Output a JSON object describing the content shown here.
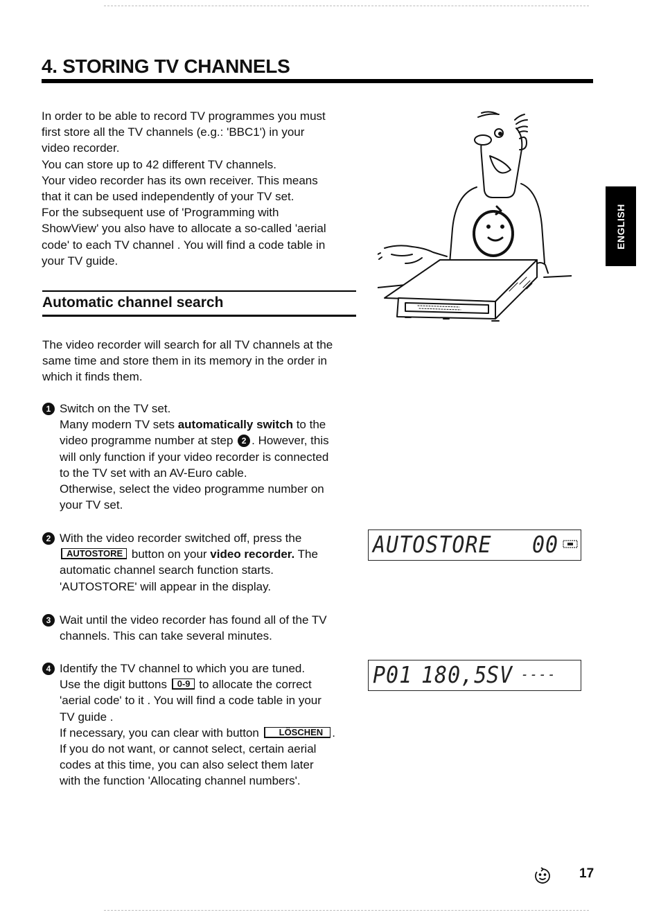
{
  "page": {
    "title": "4. STORING TV CHANNELS",
    "language_tab": "ENGLISH",
    "page_number": "17",
    "footer_icon": "smiley-recycle-icon"
  },
  "intro": {
    "lines": [
      "In order to be able to record TV programmes you must",
      "first store all the TV channels (e.g.: 'BBC1') in your",
      "video recorder.",
      "You can store up to 42 different TV channels.",
      "Your video recorder has its own receiver. This means",
      "that it can be used independently of your TV set.",
      "For the subsequent use of 'Programming with",
      "ShowView' you also have to allocate a so-called 'aerial",
      "code' to each TV channel . You will find a code table in",
      "your TV guide."
    ]
  },
  "section": {
    "title": "Automatic channel search",
    "intro_lines": [
      "The video recorder will search for all TV channels at the",
      "same time and store them in its memory in the order in",
      "which it finds them."
    ]
  },
  "steps": [
    {
      "number": "1",
      "l1": "Switch on the TV set.",
      "l2a": "Many modern TV sets ",
      "l2b": "automatically switch",
      "l2c": " to the",
      "l3a": "video programme number at step ",
      "l3ref": "2",
      "l3b": ". However, this",
      "l4": "will only function if your video recorder is connected",
      "l5": "to the TV set with an AV-Euro cable.",
      "l6": "Otherwise, select the video programme number on",
      "l7": "your TV set."
    },
    {
      "number": "2",
      "l1": "With the video recorder switched off, press the",
      "key": "AUTOSTORE",
      "l2a": " button on your ",
      "l2b": "video recorder.",
      "l2c": " The",
      "l3": "automatic channel search function starts.",
      "l4": "'AUTOSTORE' will appear in the display."
    },
    {
      "number": "3",
      "l1": "Wait until the video recorder has found all of the TV",
      "l2": "channels. This can take several minutes."
    },
    {
      "number": "4",
      "l1": "Identify the TV channel to which you are tuned.",
      "l2a": "Use the digit buttons ",
      "key1": "0-9",
      "l2b": " to allocate the correct",
      "l3": "'aerial code' to it . You will find a code table in your",
      "l4": "TV guide .",
      "l5a": "If necessary, you can clear with button ",
      "key2": "LÖSCHEN",
      "l5b": ".",
      "l6": "If you do not want, or cannot select, certain aerial",
      "l7": "codes at this time, you can also select them later",
      "l8": "with the function 'Allocating channel numbers'."
    }
  ],
  "displays": {
    "autostore": {
      "text": "AUTOSTORE",
      "counter": "00",
      "icon": "cassette-icon"
    },
    "channel": {
      "programme": "P01",
      "frequency": "180,5",
      "channel": "SV",
      "code": "----"
    }
  },
  "illustration": {
    "subject": "smiling man presenting a video recorder"
  }
}
